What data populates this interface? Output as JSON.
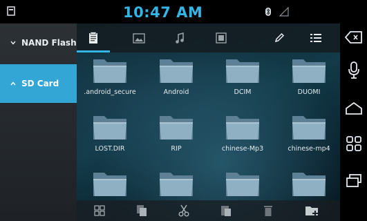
{
  "status": {
    "time": "10:47 AM"
  },
  "storage": {
    "items": [
      {
        "label": "NAND Flash",
        "selected": false
      },
      {
        "label": "SD Card",
        "selected": true
      }
    ]
  },
  "tabs": [
    "files-icon",
    "image-icon",
    "music-icon",
    "video-icon",
    "pencil-icon",
    "list-icon"
  ],
  "folders": [
    {
      "name": ".android_secure"
    },
    {
      "name": "Android"
    },
    {
      "name": "DCIM"
    },
    {
      "name": "DUOMI"
    },
    {
      "name": "LOST.DIR"
    },
    {
      "name": "RIP"
    },
    {
      "name": "chinese-Mp3"
    },
    {
      "name": "chinese-mp4"
    },
    {
      "name": ""
    },
    {
      "name": ""
    },
    {
      "name": ""
    },
    {
      "name": ""
    }
  ],
  "actions": [
    "select-all-icon",
    "copy-icon",
    "cut-icon",
    "paste-icon",
    "delete-icon",
    "new-folder-icon"
  ],
  "nav": [
    "back-icon",
    "mic-icon",
    "home-icon",
    "apps-icon",
    "recents-icon"
  ],
  "colors": {
    "accent": "#33b5e5",
    "selected_storage": "#33a6d6",
    "folder": "#7fa3b8"
  }
}
